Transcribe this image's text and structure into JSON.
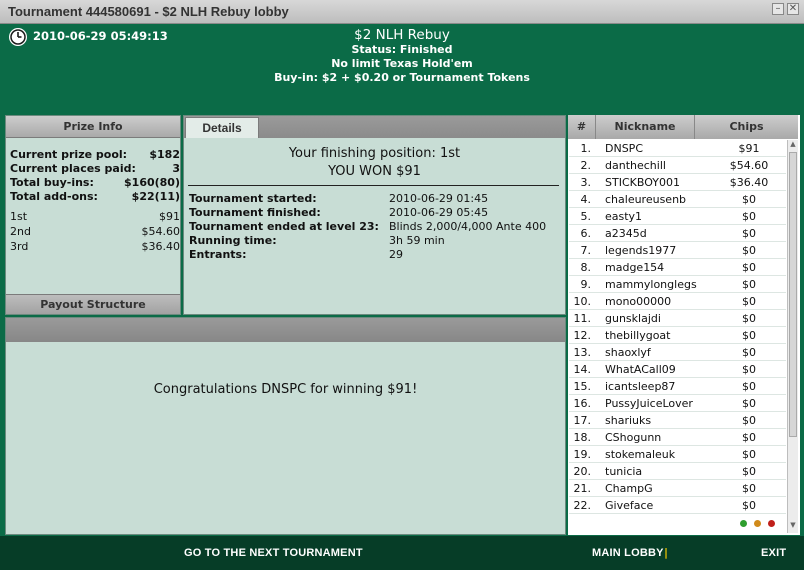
{
  "window": {
    "title": "Tournament 444580691 - $2 NLH Rebuy lobby",
    "minimize_glyph": "–",
    "close_glyph": "✕"
  },
  "header": {
    "datetime": "2010-06-29 05:49:13",
    "tournament_name": "$2 NLH Rebuy",
    "status": "Status: Finished",
    "game": "No limit Texas Hold'em",
    "buyin": "Buy-in: $2 + $0.20 or Tournament Tokens"
  },
  "prize_info": {
    "tab_label": "Prize Info",
    "rows": [
      {
        "label": "Current prize pool:",
        "value": "$182"
      },
      {
        "label": "Current places paid:",
        "value": "3"
      },
      {
        "label": "Total buy-ins:",
        "value": "$160(80)"
      },
      {
        "label": "Total add-ons:",
        "value": "$22(11)"
      }
    ],
    "payouts": [
      {
        "place": "1st",
        "amount": "$91"
      },
      {
        "place": "2nd",
        "amount": "$54.60"
      },
      {
        "place": "3rd",
        "amount": "$36.40"
      }
    ],
    "payout_structure_label": "Payout Structure"
  },
  "details": {
    "tab_label": "Details",
    "finishing_position": "Your finishing position:  1st",
    "you_won": "YOU WON $91",
    "rows": [
      {
        "label": "Tournament started:",
        "value": "2010-06-29 01:45"
      },
      {
        "label": "Tournament finished:",
        "value": "2010-06-29 05:45"
      },
      {
        "label": "Tournament ended at level 23:",
        "value": "Blinds 2,000/4,000 Ante 400"
      },
      {
        "label": "Running time:",
        "value": "3h 59 min"
      },
      {
        "label": "Entrants:",
        "value": "29"
      }
    ]
  },
  "congrats": {
    "message": "Congratulations DNSPC for winning $91!"
  },
  "players": {
    "headers": {
      "num": "#",
      "nickname": "Nickname",
      "chips": "Chips"
    },
    "rows": [
      {
        "num": "1.",
        "nick": "DNSPC",
        "chips": "$91"
      },
      {
        "num": "2.",
        "nick": "danthechill",
        "chips": "$54.60"
      },
      {
        "num": "3.",
        "nick": "STICKBOY001",
        "chips": "$36.40"
      },
      {
        "num": "4.",
        "nick": "chaleureusenb",
        "chips": "$0"
      },
      {
        "num": "5.",
        "nick": "easty1",
        "chips": "$0"
      },
      {
        "num": "6.",
        "nick": "a2345d",
        "chips": "$0"
      },
      {
        "num": "7.",
        "nick": "legends1977",
        "chips": "$0"
      },
      {
        "num": "8.",
        "nick": "madge154",
        "chips": "$0"
      },
      {
        "num": "9.",
        "nick": "mammylonglegs",
        "chips": "$0"
      },
      {
        "num": "10.",
        "nick": "mono00000",
        "chips": "$0"
      },
      {
        "num": "11.",
        "nick": "gunsklajdi",
        "chips": "$0"
      },
      {
        "num": "12.",
        "nick": "thebillygoat",
        "chips": "$0"
      },
      {
        "num": "13.",
        "nick": "shaoxlyf",
        "chips": "$0"
      },
      {
        "num": "14.",
        "nick": "WhatACall09",
        "chips": "$0"
      },
      {
        "num": "15.",
        "nick": "icantsleep87",
        "chips": "$0"
      },
      {
        "num": "16.",
        "nick": "PussyJuiceLover",
        "chips": "$0"
      },
      {
        "num": "17.",
        "nick": "shariuks",
        "chips": "$0"
      },
      {
        "num": "18.",
        "nick": "CShogunn",
        "chips": "$0"
      },
      {
        "num": "19.",
        "nick": "stokemaleuk",
        "chips": "$0"
      },
      {
        "num": "20.",
        "nick": "tunicia",
        "chips": "$0"
      },
      {
        "num": "21.",
        "nick": "ChampG",
        "chips": "$0"
      },
      {
        "num": "22.",
        "nick": "Giveface",
        "chips": "$0"
      }
    ],
    "status_dots": [
      "#2e9e2e",
      "#d08a1a",
      "#c0201a"
    ]
  },
  "footer": {
    "next_tournament": "GO TO THE NEXT TOURNAMENT",
    "main_lobby": "MAIN LOBBY",
    "separator": "|",
    "exit": "EXIT"
  },
  "colors": {
    "header_green": "#0b6b47",
    "footer_green": "#063d27",
    "panel_bg": "#c8ddd5",
    "separator_yellow": "#e8c000"
  }
}
